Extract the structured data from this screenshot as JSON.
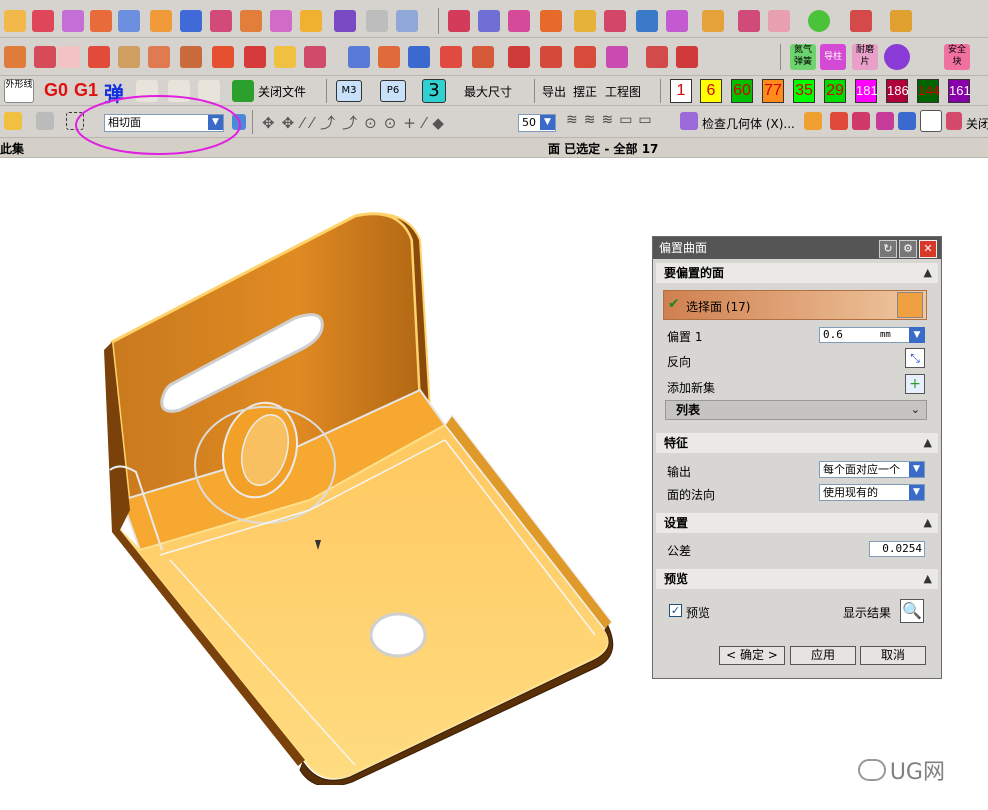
{
  "toolbar3": {
    "outline_line": "外形线",
    "g0": "G0",
    "g1": "G1",
    "spring": "弹",
    "close_file": "关闭文件",
    "m3": "M3",
    "p6": "P6",
    "digit3": "3",
    "max_size": "最大尺寸",
    "export": "导出",
    "align": "摆正",
    "drawing": "工程图",
    "numbers": [
      {
        "text": "1",
        "bg": "#ffffff",
        "fg": "#d40000"
      },
      {
        "text": "6",
        "bg": "#ffff00",
        "fg": "#d40000"
      },
      {
        "text": "60",
        "bg": "#00c000",
        "fg": "#d40000"
      },
      {
        "text": "77",
        "bg": "#ff8c1a",
        "fg": "#d40000"
      },
      {
        "text": "35",
        "bg": "#00ff00",
        "fg": "#d40000"
      },
      {
        "text": "29",
        "bg": "#00dd00",
        "fg": "#d40000"
      },
      {
        "text": "181",
        "bg": "#ff00ff",
        "fg": "#ffffff"
      },
      {
        "text": "186",
        "bg": "#b0003a",
        "fg": "#ffffff"
      },
      {
        "text": "144",
        "bg": "#006400",
        "fg": "#d40000"
      },
      {
        "text": "161",
        "bg": "#8800aa",
        "fg": "#ffffff"
      }
    ]
  },
  "toolbar2": {
    "gas_spring": "氮气弹簧",
    "guide_pillar": "导柱",
    "wear_plate": "耐磨片",
    "safety": "安全块"
  },
  "toolbar4": {
    "face_rule_select": "相切面",
    "count_select": "50",
    "check_geometry": "检查几何体 (X)...",
    "close_label": "关闭"
  },
  "statusbar": {
    "left": "此集",
    "center": "面 已选定 - 全部 17"
  },
  "dialog": {
    "title": "偏置曲面",
    "section_faces": "要偏置的面",
    "select_face_label": "选择面 (17)",
    "offset_label": "偏置 1",
    "offset_value": "0.6",
    "offset_unit": "mm",
    "reverse_label": "反向",
    "add_new_set_label": "添加新集",
    "list_label": "列表",
    "section_feature": "特征",
    "output_label": "输出",
    "output_value": "每个面对应一个",
    "normal_label": "面的法向",
    "normal_value": "使用现有的",
    "section_settings": "设置",
    "tolerance_label": "公差",
    "tolerance_value": "0.0254",
    "section_preview": "预览",
    "preview_label": "预览",
    "show_result_label": "显示结果",
    "ok_button": "< 确定 >",
    "apply_button": "应用",
    "cancel_button": "取消"
  },
  "watermark": "UG网",
  "colors": {
    "toolbar_bg": "#d6d3ce",
    "part_orange": "#f4a83c",
    "annotation_magenta": "#e020e0",
    "dialog_title": "#555555",
    "selected_row": "#e8a868"
  }
}
